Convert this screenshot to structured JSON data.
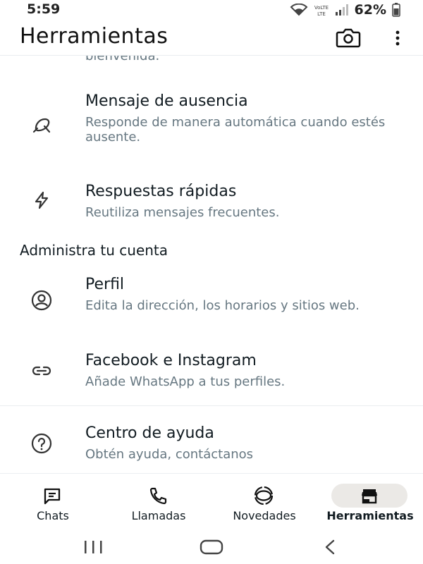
{
  "status_bar": {
    "time": "5:59",
    "network_label": "VoLTE",
    "battery": "62%"
  },
  "app_bar": {
    "title": "Herramientas"
  },
  "partial_item": {
    "text": "bienvenida."
  },
  "items": [
    {
      "title": "Mensaje de ausencia",
      "subtitle": "Responde de manera automática cuando estés ausente.",
      "icon": "away-message-icon"
    },
    {
      "title": "Respuestas rápidas",
      "subtitle": "Reutiliza mensajes frecuentes.",
      "icon": "lightning-icon"
    }
  ],
  "section": {
    "title": "Administra tu cuenta"
  },
  "account_items": [
    {
      "title": "Perfil",
      "subtitle": "Edita la dirección, los horarios y sitios web.",
      "icon": "profile-icon"
    },
    {
      "title": "Facebook e Instagram",
      "subtitle": "Añade WhatsApp a tus perfiles.",
      "icon": "link-icon"
    }
  ],
  "help_item": {
    "title": "Centro de ayuda",
    "subtitle": "Obtén ayuda, contáctanos",
    "icon": "help-icon"
  },
  "bottom_nav": [
    {
      "label": "Chats",
      "icon": "chat-icon",
      "active": false
    },
    {
      "label": "Llamadas",
      "icon": "phone-icon",
      "active": false
    },
    {
      "label": "Novedades",
      "icon": "updates-icon",
      "active": false
    },
    {
      "label": "Herramientas",
      "icon": "store-icon",
      "active": true
    }
  ],
  "colors": {
    "active_pill": "#ebe9e6",
    "secondary_text": "#667781"
  }
}
